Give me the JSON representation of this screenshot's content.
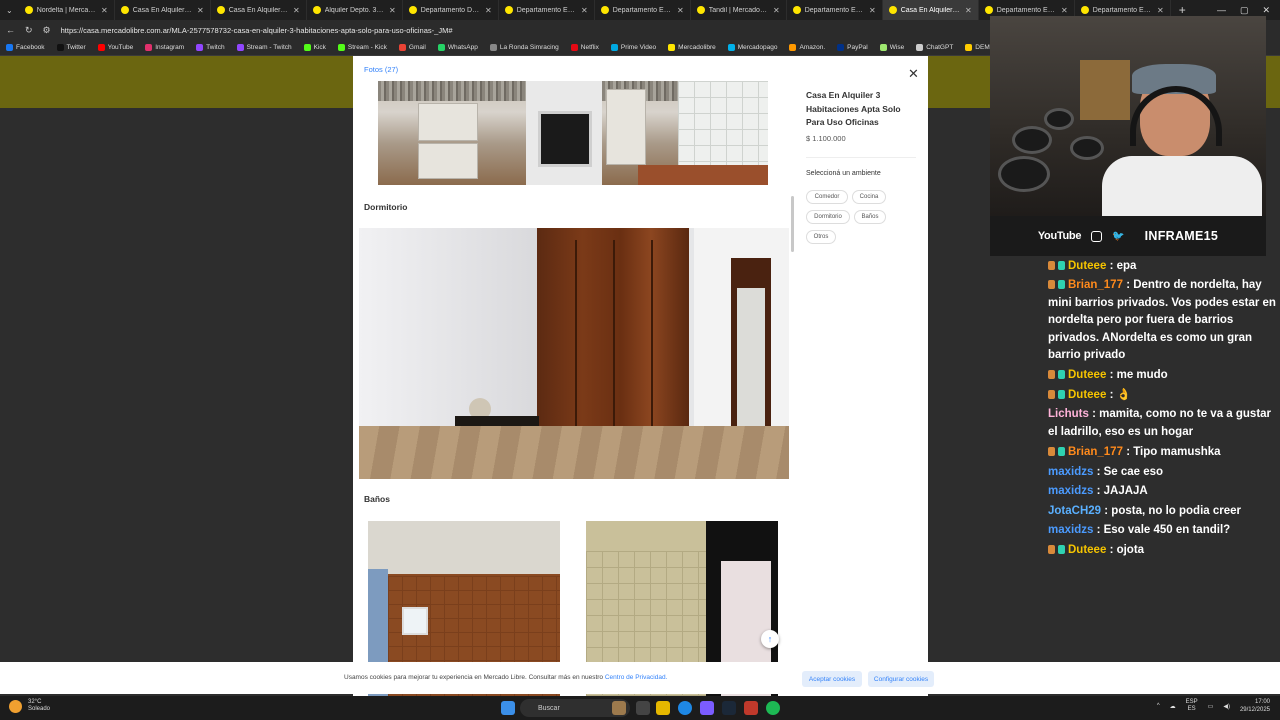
{
  "browser": {
    "tabs": [
      {
        "title": "Nordelta | Mercado Libre",
        "active": false
      },
      {
        "title": "Casa En Alquiler Ubicada",
        "active": false
      },
      {
        "title": "Casa En Alquiler En Castelar",
        "active": false
      },
      {
        "title": "Alquiler Depto. 3 Ambientes",
        "active": false
      },
      {
        "title": "Departamento Dúplex En",
        "active": false
      },
      {
        "title": "Departamento En Alquiler",
        "active": false
      },
      {
        "title": "Departamento En Alquiler",
        "active": false
      },
      {
        "title": "Tandil | MercadoLibre",
        "active": false
      },
      {
        "title": "Departamento En Alquiler",
        "active": false
      },
      {
        "title": "Casa En Alquiler 3 Habitaciones",
        "active": true
      },
      {
        "title": "Departamento En Alquiler",
        "active": false
      },
      {
        "title": "Departamento En Alquiler",
        "active": false
      }
    ],
    "new_tab": "+",
    "url": "https://casa.mercadolibre.com.ar/MLA-2577578732-casa-en-alquiler-3-habitaciones-apta-solo-para-uso-oficinas-_JM#",
    "bookmarks": [
      {
        "label": "Facebook",
        "color": "#1877f2"
      },
      {
        "label": "Twitter",
        "color": "#111111"
      },
      {
        "label": "YouTube",
        "color": "#ff0000"
      },
      {
        "label": "Instagram",
        "color": "#e1306c"
      },
      {
        "label": "Twitch",
        "color": "#9146ff"
      },
      {
        "label": "Stream - Twitch",
        "color": "#9146ff"
      },
      {
        "label": "Kick",
        "color": "#53fc18"
      },
      {
        "label": "Stream - Kick",
        "color": "#53fc18"
      },
      {
        "label": "Gmail",
        "color": "#ea4335"
      },
      {
        "label": "WhatsApp",
        "color": "#25d366"
      },
      {
        "label": "La Ronda Simracing",
        "color": "#888888"
      },
      {
        "label": "Netflix",
        "color": "#e50914"
      },
      {
        "label": "Prime Video",
        "color": "#00a8e1"
      },
      {
        "label": "Mercadolibre",
        "color": "#ffe600"
      },
      {
        "label": "Mercadopago",
        "color": "#00b1ea"
      },
      {
        "label": "Amazon.",
        "color": "#ff9900"
      },
      {
        "label": "PayPal",
        "color": "#003087"
      },
      {
        "label": "Wise",
        "color": "#9fe870"
      },
      {
        "label": "ChatGPT",
        "color": "#cccccc"
      },
      {
        "label": "DEMOS PAL STREA...",
        "color": "#ffcc00"
      }
    ]
  },
  "gallery": {
    "tab_label": "Fotos (27)",
    "sections": [
      "Dormitorio",
      "Baños"
    ],
    "scroll_top_icon": "↑"
  },
  "listing": {
    "title": "Casa En Alquiler 3 Habitaciones Apta Solo Para Uso Oficinas",
    "price": "$ 1.100.000",
    "close_icon": "✕",
    "ambient_title": "Seleccioná un ambiente",
    "chips": [
      "Comedor",
      "Cocina",
      "Dormitorio",
      "Baños",
      "Otros"
    ]
  },
  "cookies": {
    "text": "Usamos cookies para mejorar tu experiencia en Mercado Libre. Consultar más en nuestro",
    "link": "Centro de Privacidad.",
    "accept": "Aceptar cookies",
    "configure": "Configurar cookies"
  },
  "taskbar": {
    "temp": "32°C",
    "weather": "Soleado",
    "search_placeholder": "Buscar",
    "lang": "ESP",
    "lang2": "ES",
    "time": "17:00",
    "date": "29/12/2025"
  },
  "overlay": {
    "social_label": "YouTube",
    "channel_name": "INFRAME15"
  },
  "chat": {
    "messages": [
      {
        "user": "Duteee",
        "text": ": epa",
        "color": "#f5c400",
        "badges": true
      },
      {
        "user": "Brian_177",
        "text": ": Dentro de nordelta, hay mini barrios privados. Vos podes estar en nordelta pero por fuera de barrios privados. ANordelta es como un gran barrio privado",
        "color": "#ff8a1c",
        "badges": true
      },
      {
        "user": "Duteee",
        "text": ": me mudo",
        "color": "#f5c400",
        "badges": true
      },
      {
        "user": "Duteee",
        "text": ": 👌",
        "color": "#f5c400",
        "badges": true
      },
      {
        "user": "Lichuts",
        "text": ": mamita, como no te va a gustar el ladrillo, eso es un hogar",
        "color": "#ffb3d9",
        "badges": false
      },
      {
        "user": "Brian_177",
        "text": ": Tipo mamushka",
        "color": "#ff8a1c",
        "badges": true
      },
      {
        "user": "maxidzs",
        "text": ": Se cae eso",
        "color": "#4b9bff",
        "badges": false
      },
      {
        "user": "maxidzs",
        "text": ": JAJAJA",
        "color": "#4b9bff",
        "badges": false
      },
      {
        "user": "JotaCH29",
        "text": ": posta, no lo podia creer",
        "color": "#5ab0ff",
        "badges": false
      },
      {
        "user": "maxidzs",
        "text": ": Eso vale 450 en tandil?",
        "color": "#4b9bff",
        "badges": false
      },
      {
        "user": "Duteee",
        "text": ": ojota",
        "color": "#f5c400",
        "badges": true
      }
    ]
  }
}
